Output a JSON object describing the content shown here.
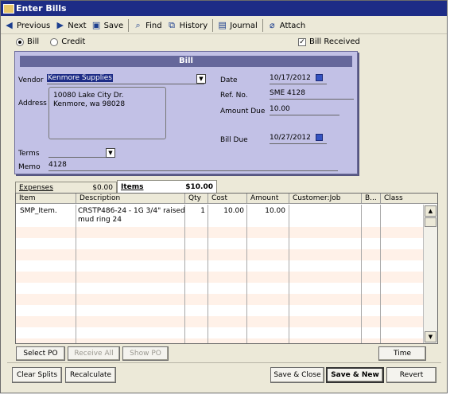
{
  "window": {
    "title": "Enter Bills"
  },
  "toolbar": {
    "previous": "Previous",
    "next": "Next",
    "save": "Save",
    "find": "Find",
    "history": "History",
    "journal": "Journal",
    "attach": "Attach"
  },
  "form_type": {
    "bill": "Bill",
    "credit": "Credit",
    "selected": "Bill"
  },
  "bill_received": {
    "label": "Bill Received",
    "checked": true
  },
  "bill": {
    "header": "Bill",
    "vendor_label": "Vendor",
    "vendor": "Kenmore Supplies",
    "address_label": "Address",
    "address_line1": "10080 Lake City Dr.",
    "address_line2": "Kenmore, wa 98028",
    "terms_label": "Terms",
    "terms": "",
    "memo_label": "Memo",
    "memo": "4128",
    "date_label": "Date",
    "date": "10/17/2012",
    "refno_label": "Ref. No.",
    "refno": "SME 4128",
    "amountdue_label": "Amount Due",
    "amountdue": "10.00",
    "billdue_label": "Bill Due",
    "billdue": "10/27/2012"
  },
  "tabs": {
    "expenses_label": "Expenses",
    "expenses_amount": "$0.00",
    "items_label": "Items",
    "items_amount": "$10.00"
  },
  "grid": {
    "headers": {
      "item": "Item",
      "description": "Description",
      "qty": "Qty",
      "cost": "Cost",
      "amount": "Amount",
      "customerjob": "Customer:Job",
      "billable": "B...",
      "class": "Class"
    },
    "rows": [
      {
        "item": "SMP_Item.",
        "description_line1": "CRSTP486-24 - 1G 3/4\" raised",
        "description_line2": "mud ring 24",
        "qty": "1",
        "cost": "10.00",
        "amount": "10.00",
        "customerjob": "",
        "billable": "",
        "class": ""
      }
    ]
  },
  "item_buttons": {
    "select_po": "Select PO",
    "receive_all": "Receive All",
    "show_po": "Show PO",
    "time": "Time"
  },
  "bottom_buttons": {
    "clear_splits": "Clear Splits",
    "recalculate": "Recalculate",
    "save_close": "Save & Close",
    "save_new": "Save & New",
    "revert": "Revert"
  }
}
